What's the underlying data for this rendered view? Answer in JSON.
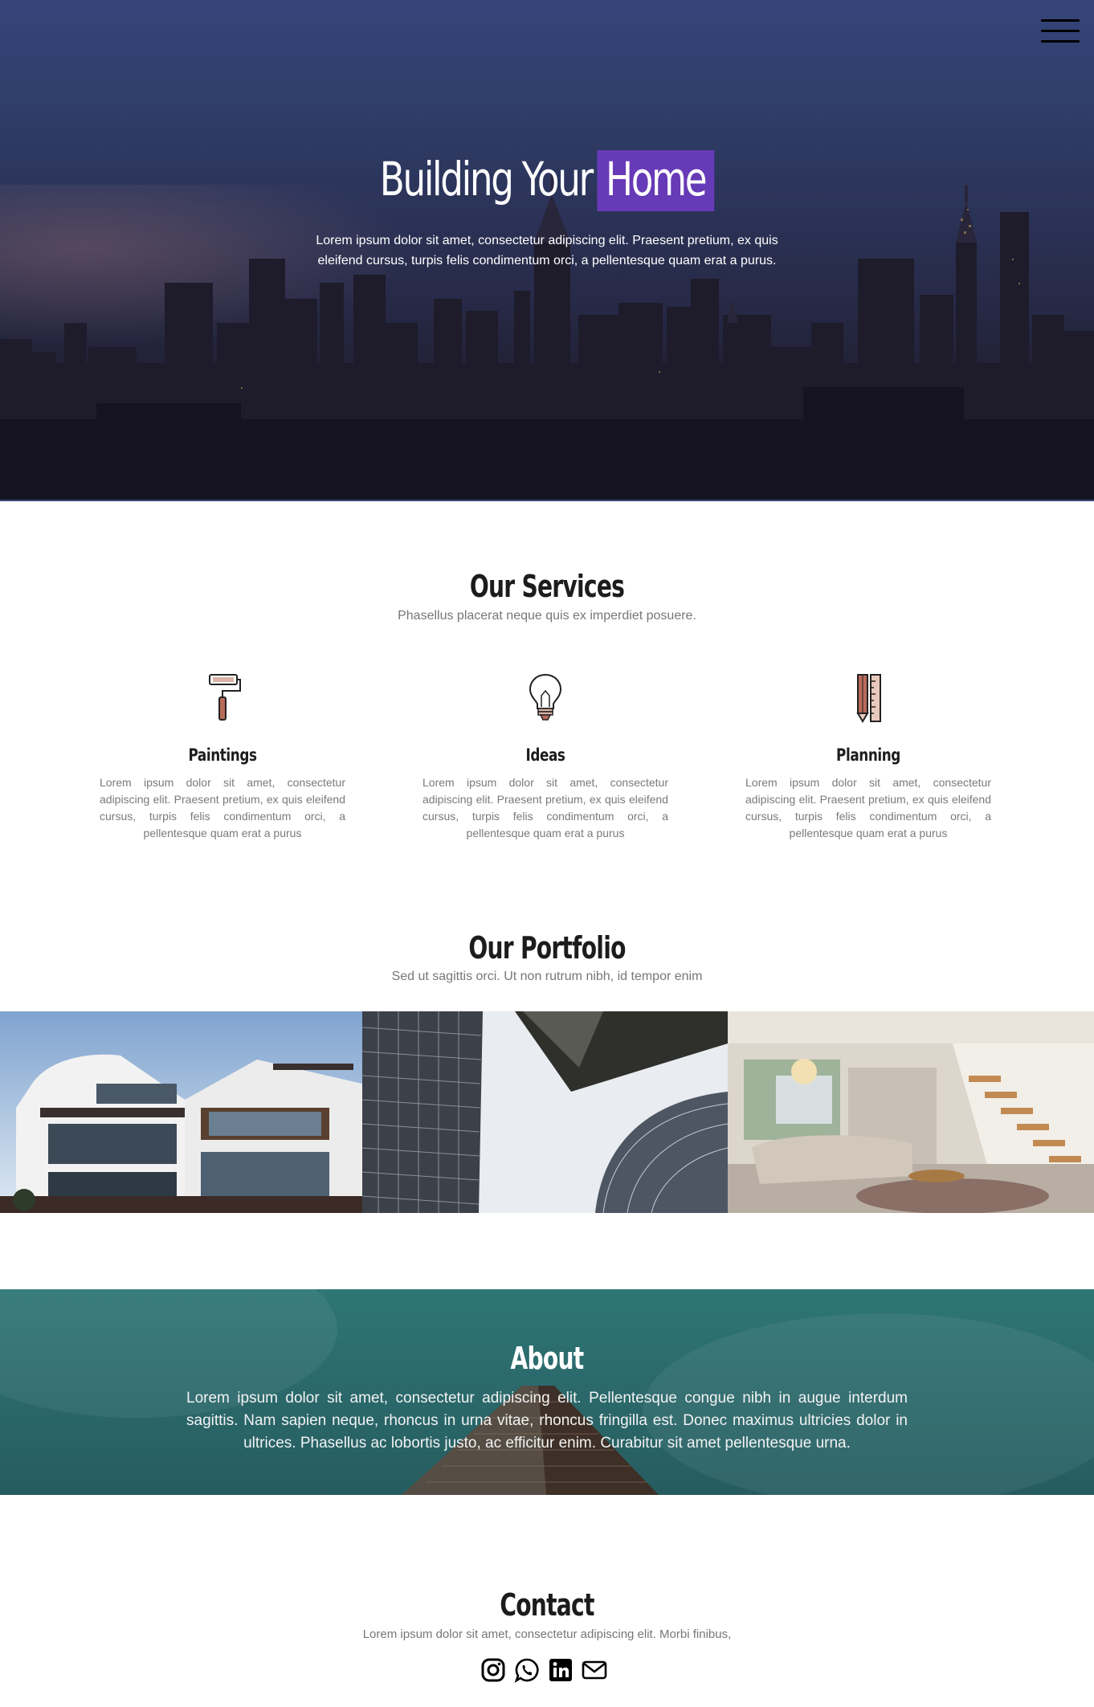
{
  "hero": {
    "title_part1": "Building Your",
    "title_highlight": "Home",
    "subtitle": "Lorem ipsum dolor sit amet, consectetur adipiscing elit. Praesent pretium, ex quis eleifend cursus, turpis felis condimentum orci, a pellentesque quam erat a purus.",
    "highlight_color": "#673ab7"
  },
  "services": {
    "title": "Our Services",
    "subtitle": "Phasellus placerat neque quis ex imperdiet posuere.",
    "items": [
      {
        "icon": "paint-roller-icon",
        "title": "Paintings",
        "text": "Lorem ipsum dolor sit amet, consectetur adipiscing elit. Praesent pretium, ex quis eleifend cursus, turpis felis condimentum orci, a pellentesque quam erat a purus"
      },
      {
        "icon": "lightbulb-icon",
        "title": "Ideas",
        "text": "Lorem ipsum dolor sit amet, consectetur adipiscing elit. Praesent pretium, ex quis eleifend cursus, turpis felis condimentum orci, a pellentesque quam erat a purus"
      },
      {
        "icon": "pencil-ruler-icon",
        "title": "Planning",
        "text": "Lorem ipsum dolor sit amet, consectetur adipiscing elit. Praesent pretium, ex quis eleifend cursus, turpis felis condimentum orci, a pellentesque quam erat a purus"
      }
    ]
  },
  "portfolio": {
    "title": "Our Portfolio",
    "subtitle": "Sed ut sagittis orci. Ut non rutrum nibh, id tempor enim"
  },
  "about": {
    "title": "About",
    "text": "Lorem ipsum dolor sit amet, consectetur adipiscing elit. Pellentesque congue nibh in augue interdum sagittis. Nam sapien neque, rhoncus in urna vitae, rhoncus fringilla est. Donec maximus ultricies dolor in ultrices. Phasellus ac lobortis justo, ac efficitur enim. Curabitur sit amet pellentesque urna."
  },
  "contact": {
    "title": "Contact",
    "subtitle": "Lorem ipsum dolor sit amet, consectetur adipiscing elit. Morbi finibus,",
    "social": [
      "instagram-icon",
      "whatsapp-icon",
      "linkedin-icon",
      "email-icon"
    ]
  }
}
